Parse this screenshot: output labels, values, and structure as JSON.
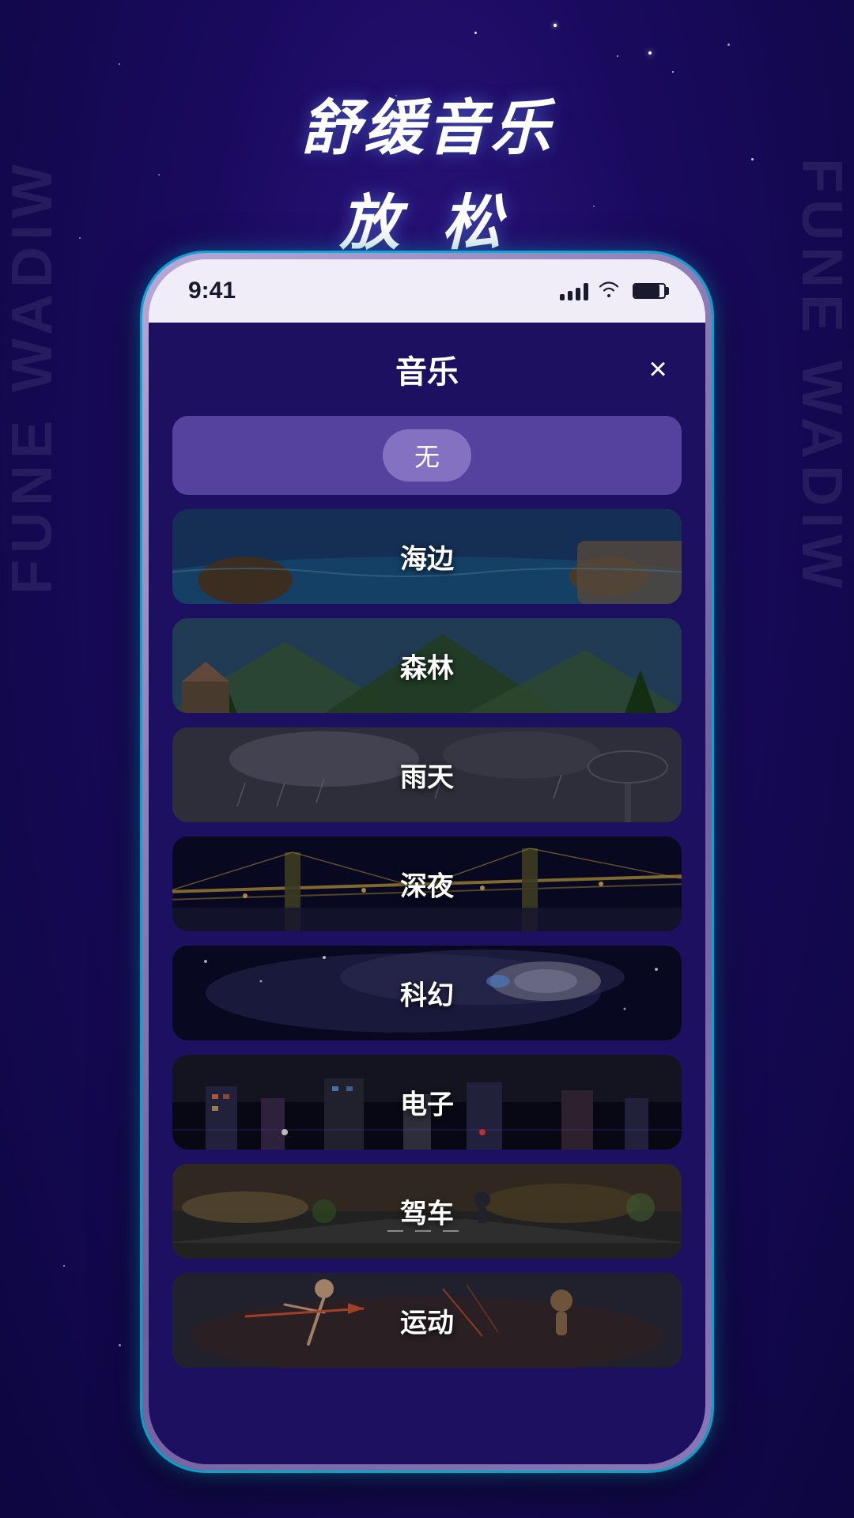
{
  "background": {
    "color": "#1a0a5e"
  },
  "side_text_left": "FUNE WADIW",
  "side_text_right": "FUNE WADIW",
  "title": {
    "line1": "舒缓音乐",
    "line2": "放  松"
  },
  "status_bar": {
    "time": "9:41",
    "signal": "●●●●",
    "wifi": "WiFi",
    "battery": "Battery"
  },
  "app": {
    "title": "音乐",
    "close_label": "×",
    "items": [
      {
        "id": "none",
        "label": "无",
        "type": "none"
      },
      {
        "id": "seaside",
        "label": "海边",
        "type": "image",
        "bg": "bg-seaside"
      },
      {
        "id": "forest",
        "label": "森林",
        "type": "image",
        "bg": "bg-forest"
      },
      {
        "id": "rainy",
        "label": "雨天",
        "type": "image",
        "bg": "bg-rainy"
      },
      {
        "id": "midnight",
        "label": "深夜",
        "type": "image",
        "bg": "bg-midnight"
      },
      {
        "id": "scifi",
        "label": "科幻",
        "type": "image",
        "bg": "bg-scifi"
      },
      {
        "id": "electronic",
        "label": "电子",
        "type": "image",
        "bg": "bg-electronic"
      },
      {
        "id": "driving",
        "label": "驾车",
        "type": "image",
        "bg": "bg-driving"
      },
      {
        "id": "sports",
        "label": "运动",
        "type": "image",
        "bg": "bg-sports"
      }
    ]
  }
}
